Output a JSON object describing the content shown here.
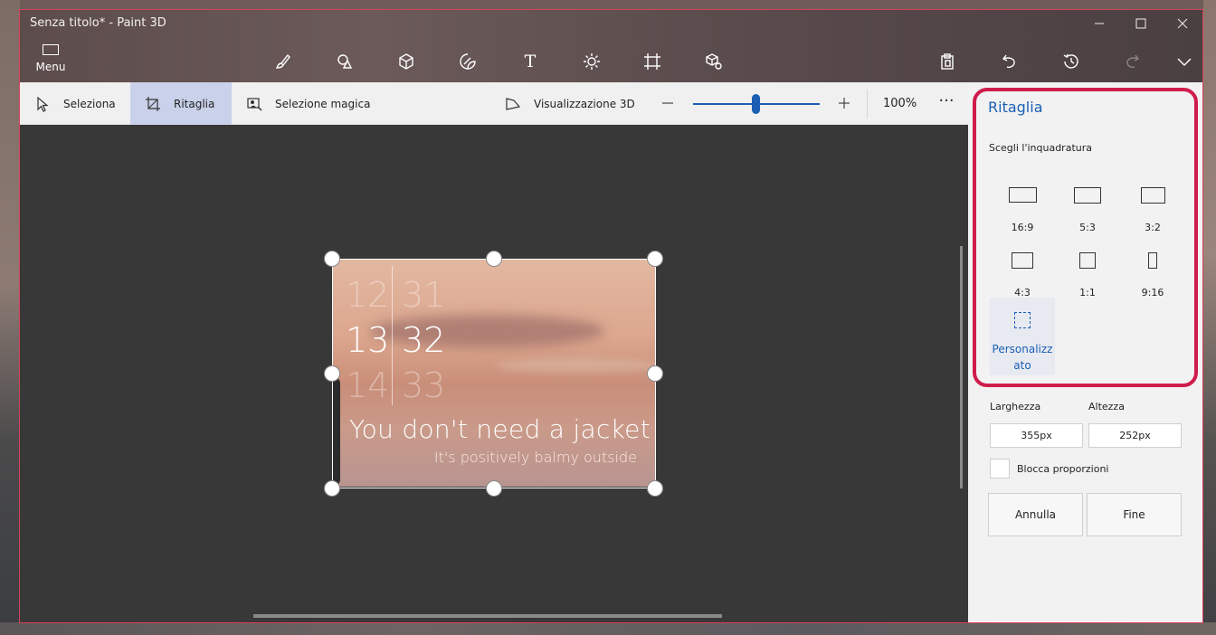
{
  "window": {
    "title": "Senza titolo* - Paint 3D"
  },
  "menu": {
    "label": "Menu"
  },
  "tools": [
    {
      "name": "brushes-icon"
    },
    {
      "name": "2d-shapes-icon"
    },
    {
      "name": "3d-shapes-icon"
    },
    {
      "name": "stickers-icon"
    },
    {
      "name": "text-icon",
      "glyph": "T"
    },
    {
      "name": "effects-icon"
    },
    {
      "name": "canvas-icon"
    },
    {
      "name": "3d-library-icon"
    }
  ],
  "toolbar": {
    "select_label": "Seleziona",
    "crop_label": "Ritaglia",
    "magic_select_label": "Selezione magica",
    "view3d_label": "Visualizzazione 3D",
    "zoom_value": "100%",
    "zoom_level": 0.5,
    "more": "···"
  },
  "image": {
    "times_left": [
      "12",
      "13",
      "14"
    ],
    "times_right": [
      "31",
      "32",
      "33"
    ],
    "headline": "You don't need a jacket",
    "subline": "It's positively balmy outside"
  },
  "panel": {
    "title": "Ritaglia",
    "subtitle": "Scegli l'inquadratura",
    "ratios": [
      "16:9",
      "5:3",
      "3:2",
      "4:3",
      "1:1",
      "9:16"
    ],
    "custom_label": "Personalizzato",
    "width_label": "Larghezza",
    "height_label": "Altezza",
    "width_value": "355px",
    "height_value": "252px",
    "lock_label": "Blocca proporzioni",
    "cancel_label": "Annulla",
    "done_label": "Fine"
  },
  "colors": {
    "accent": "#1a5fb4",
    "highlight": "#d01c4c"
  }
}
